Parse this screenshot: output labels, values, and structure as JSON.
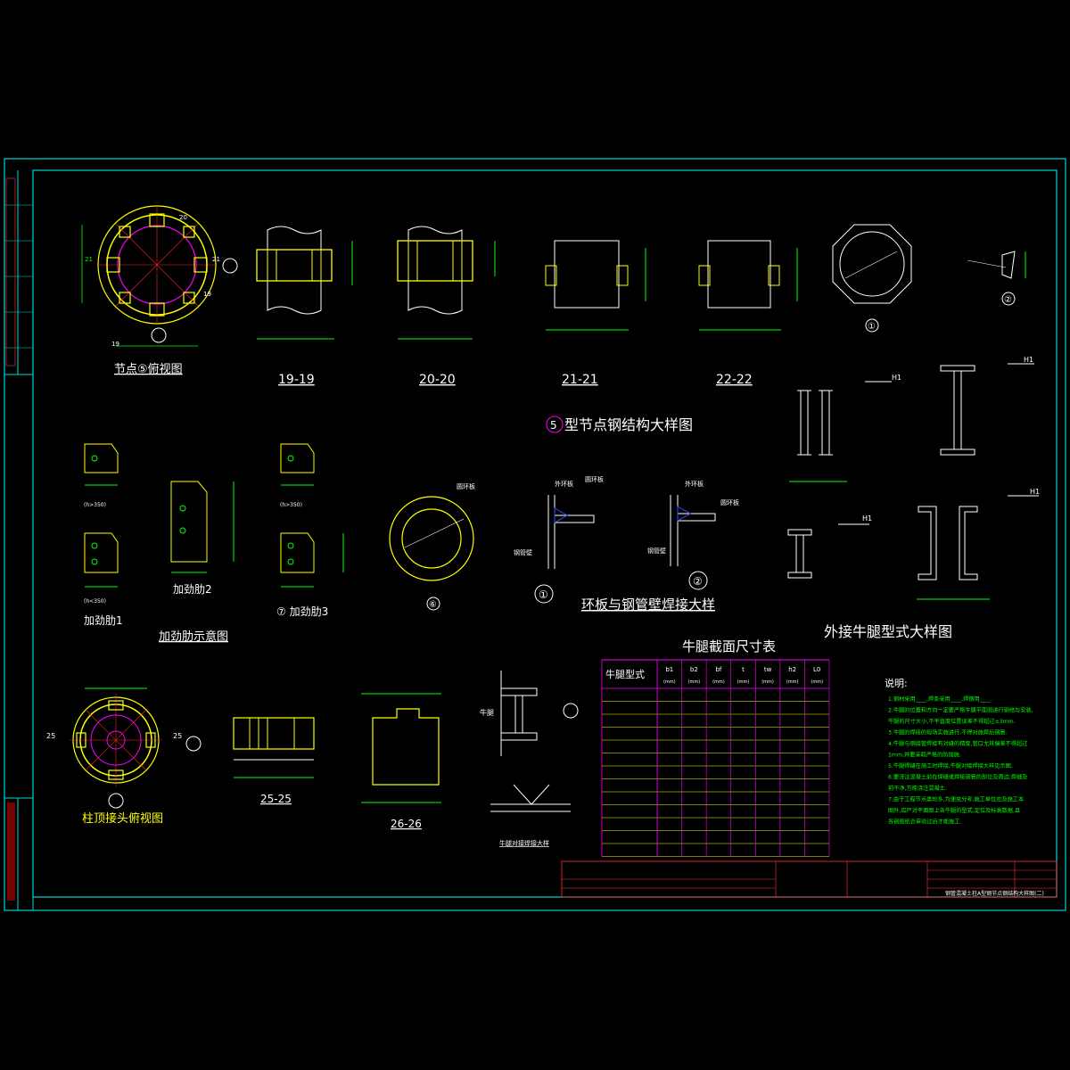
{
  "labels": {
    "node5_top": "节点⑤俯视图",
    "sec_19": "19-19",
    "sec_20": "20-20",
    "sec_21": "21-21",
    "sec_22": "22-22",
    "detail_1": "①",
    "detail_2": "②",
    "node5_title_num": "5",
    "node5_title": "型节点钢结构大样图",
    "rib1": "加劲肋1",
    "rib2": "加劲肋2",
    "rib3": "⑦ 加劲肋3",
    "rib_title": "加劲肋示意图",
    "detail_6": "⑥",
    "ring_label": "圆环板",
    "outer_plate": "外环板",
    "ring_plate": "圆环板",
    "tube_wall": "钢管壁",
    "weld_1": "①",
    "weld_2": "②",
    "weld_title": "环板与钢管壁焊接大样",
    "bracket_title": "外接牛腿型式大样图",
    "h1": "H1",
    "table_title": "牛腿截面尺寸表",
    "column_top": "柱顶接头俯视图",
    "sec_25": "25-25",
    "sec_26": "26-26",
    "bracket": "牛腿",
    "bracket_weld": "牛腿对接焊接大样",
    "notes_title": "说明:",
    "h_note1": "(h<350)",
    "h_note2": "(h>350)",
    "n19": "19",
    "n20": "20",
    "n21": "21",
    "n25": "25"
  },
  "table": {
    "header_first": "牛腿型式",
    "columns": [
      "b1",
      "b2",
      "bf",
      "t",
      "tw",
      "h2",
      "L0"
    ],
    "units": "(mm)",
    "empty_rows": 13
  },
  "notes": [
    "1.钢材采用____,焊条采用____,焊钢用____.",
    "2.牛腿的位置和方向一定要严格牛腿平面图进行钢结与安装,",
    "  牛腿的尺寸大小,不平直度位置误差不得超过±3mm.",
    "3.牛腿的焊接的现场实施进行,不得对施焊后钢管.",
    "4.牛腿与钢接管焊接有对缝的精度,管口尤其偏差不得超过",
    "  1mm,并要采取严格的防措施.",
    "5.牛腿焊缝在施工时焊接,牛腿对接焊接大样见示图.",
    "6.要浇注混凝土前在焊缝或焊接钢管的部位及周边,焊缝及",
    "  前干净,方能浇注混凝土.",
    "7.由于工程节点类较多,为便充分考,施工单位应及施工本",
    "  图外,应严对平面图上各牛腿的型式,定位及标高数据,且",
    "  各钢图纸合审验过后才能施工."
  ],
  "title_block": {
    "drawing_name": "钢管混凝土柱A型钢节点钢结构大样图(二)"
  }
}
